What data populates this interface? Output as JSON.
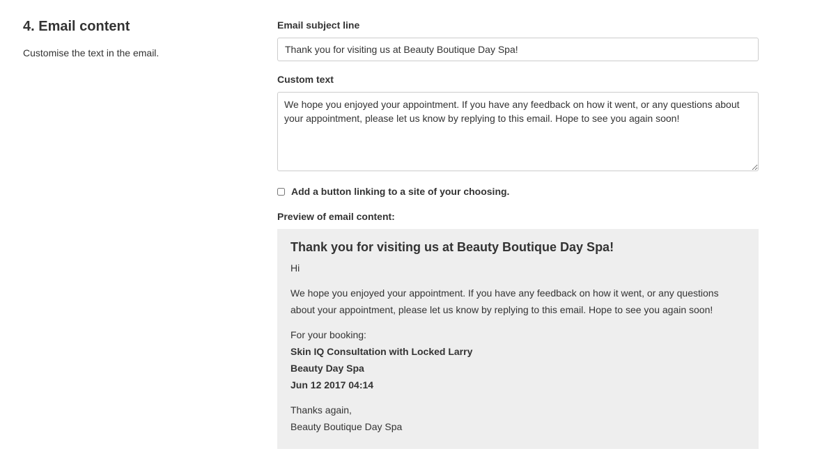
{
  "section": {
    "title": "4. Email content",
    "description": "Customise the text in the email."
  },
  "subject": {
    "label": "Email subject line",
    "value": "Thank you for visiting us at Beauty Boutique Day Spa!"
  },
  "custom_text": {
    "label": "Custom text",
    "value": "We hope you enjoyed your appointment. If you have any feedback on how it went, or any questions about your appointment, please let us know by replying to this email. Hope to see you again soon!"
  },
  "button_option": {
    "label": "Add a button linking to a site of your choosing.",
    "checked": false
  },
  "preview": {
    "label": "Preview of email content:",
    "title": "Thank you for visiting us at Beauty Boutique Day Spa!",
    "greeting": "Hi",
    "body": "We hope you enjoyed your appointment. If you have any feedback on how it went, or any questions about your appointment, please let us know by replying to this email. Hope to see you again soon!",
    "booking_intro": "For your booking:",
    "service": "Skin IQ Consultation with Locked Larry",
    "location": "Beauty Day Spa",
    "datetime": "Jun 12 2017 04:14",
    "thanks": "Thanks again,",
    "signature": "Beauty Boutique Day Spa"
  },
  "colors": {
    "text": "#333333",
    "preview_background": "#eeeeee",
    "input_border": "#cccccc"
  }
}
